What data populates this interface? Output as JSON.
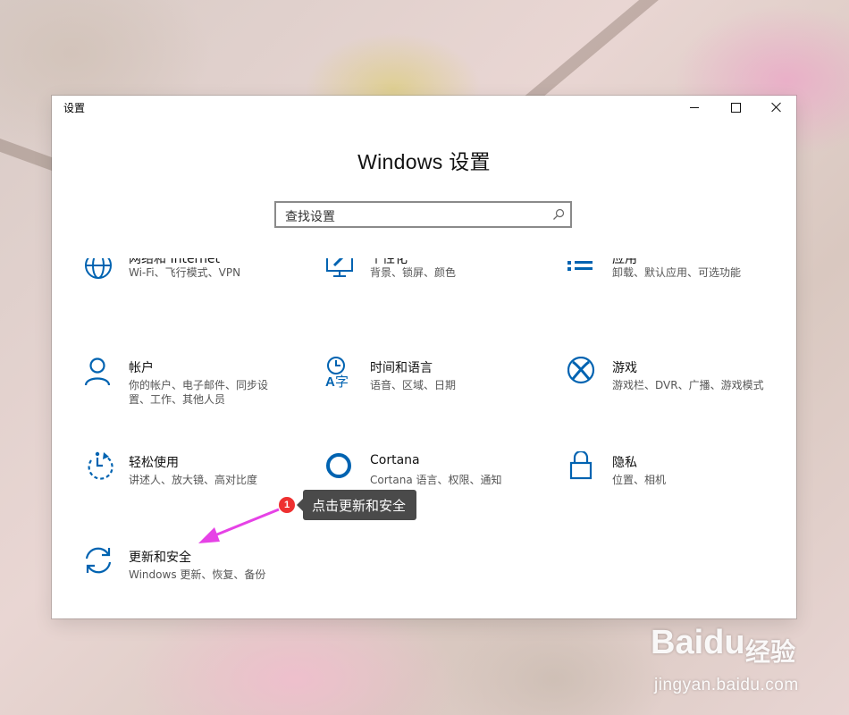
{
  "window": {
    "title": "设置",
    "heading": "Windows 设置",
    "search_placeholder": "查找设置"
  },
  "tiles": [
    {
      "name": "网络和 Internet",
      "desc": "Wi-Fi、飞行模式、VPN",
      "icon": "globe-icon"
    },
    {
      "name": "个性化",
      "desc": "背景、锁屏、颜色",
      "icon": "personalization-icon"
    },
    {
      "name": "应用",
      "desc": "卸载、默认应用、可选功能",
      "icon": "apps-list-icon"
    },
    {
      "name": "帐户",
      "desc": "你的帐户、电子邮件、同步设置、工作、其他人员",
      "icon": "person-icon"
    },
    {
      "name": "时间和语言",
      "desc": "语音、区域、日期",
      "icon": "time-language-icon"
    },
    {
      "name": "游戏",
      "desc": "游戏栏、DVR、广播、游戏模式",
      "icon": "xbox-icon"
    },
    {
      "name": "轻松使用",
      "desc": "讲述人、放大镜、高对比度",
      "icon": "ease-of-access-icon"
    },
    {
      "name": "Cortana",
      "desc": "Cortana 语言、权限、通知",
      "icon": "cortana-icon"
    },
    {
      "name": "隐私",
      "desc": "位置、相机",
      "icon": "lock-icon"
    },
    {
      "name": "更新和安全",
      "desc": "Windows 更新、恢复、备份",
      "icon": "sync-icon"
    }
  ],
  "annotation": {
    "badge": "1",
    "callout": "点击更新和安全"
  },
  "watermark": {
    "logo": "Baidu",
    "logo_suffix": "经验",
    "url": "jingyan.baidu.com"
  },
  "colors": {
    "accent": "#0063b1",
    "arrow": "#e642e6",
    "badge": "#ee3030",
    "callout_bg": "#4a4a4a"
  }
}
